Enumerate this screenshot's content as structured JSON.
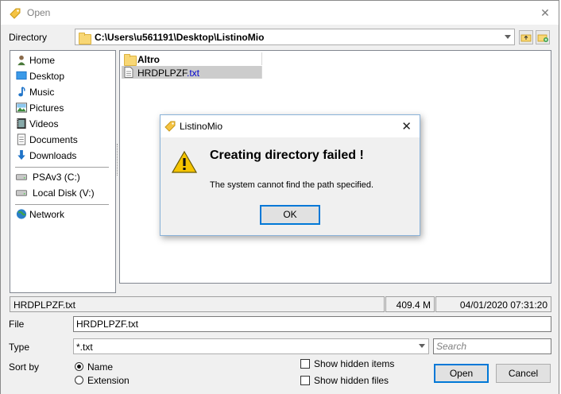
{
  "window": {
    "title": "Open"
  },
  "directory": {
    "label": "Directory",
    "path": "C:\\Users\\u561191\\Desktop\\ListinoMio"
  },
  "places": [
    {
      "label": "Home",
      "icon": "home-icon"
    },
    {
      "label": "Desktop",
      "icon": "desktop-icon"
    },
    {
      "label": "Music",
      "icon": "music-icon"
    },
    {
      "label": "Pictures",
      "icon": "pictures-icon"
    },
    {
      "label": "Videos",
      "icon": "videos-icon"
    },
    {
      "label": "Documents",
      "icon": "documents-icon"
    },
    {
      "label": "Downloads",
      "icon": "downloads-icon"
    },
    {
      "label": "PSAv3 (C:)",
      "icon": "drive-icon"
    },
    {
      "label": "Local Disk (V:)",
      "icon": "drive-icon"
    },
    {
      "label": "Network",
      "icon": "network-icon"
    }
  ],
  "files": [
    {
      "name": "Altro",
      "type": "folder"
    },
    {
      "name": "HRDPLPZF",
      "ext": ".txt",
      "type": "file",
      "selected": true
    }
  ],
  "status": {
    "name": "HRDPLPZF.txt",
    "size": "409.4 M",
    "date": "04/01/2020 07:31:20"
  },
  "file_field": {
    "label": "File",
    "value": "HRDPLPZF.txt"
  },
  "type_field": {
    "label": "Type",
    "value": "*.txt"
  },
  "search": {
    "placeholder": "Search"
  },
  "sort": {
    "label": "Sort by",
    "options": [
      "Name",
      "Extension"
    ],
    "selected": "Name"
  },
  "checks": {
    "hidden_items": "Show hidden items",
    "hidden_files": "Show hidden files"
  },
  "buttons": {
    "open": "Open",
    "cancel": "Cancel"
  },
  "dialog": {
    "title": "ListinoMio",
    "heading": "Creating directory failed !",
    "message": "The system cannot find the path specified.",
    "ok": "OK"
  },
  "colors": {
    "accent": "#0078d7",
    "selection": "#cccccc",
    "extension": "#0000cc"
  }
}
